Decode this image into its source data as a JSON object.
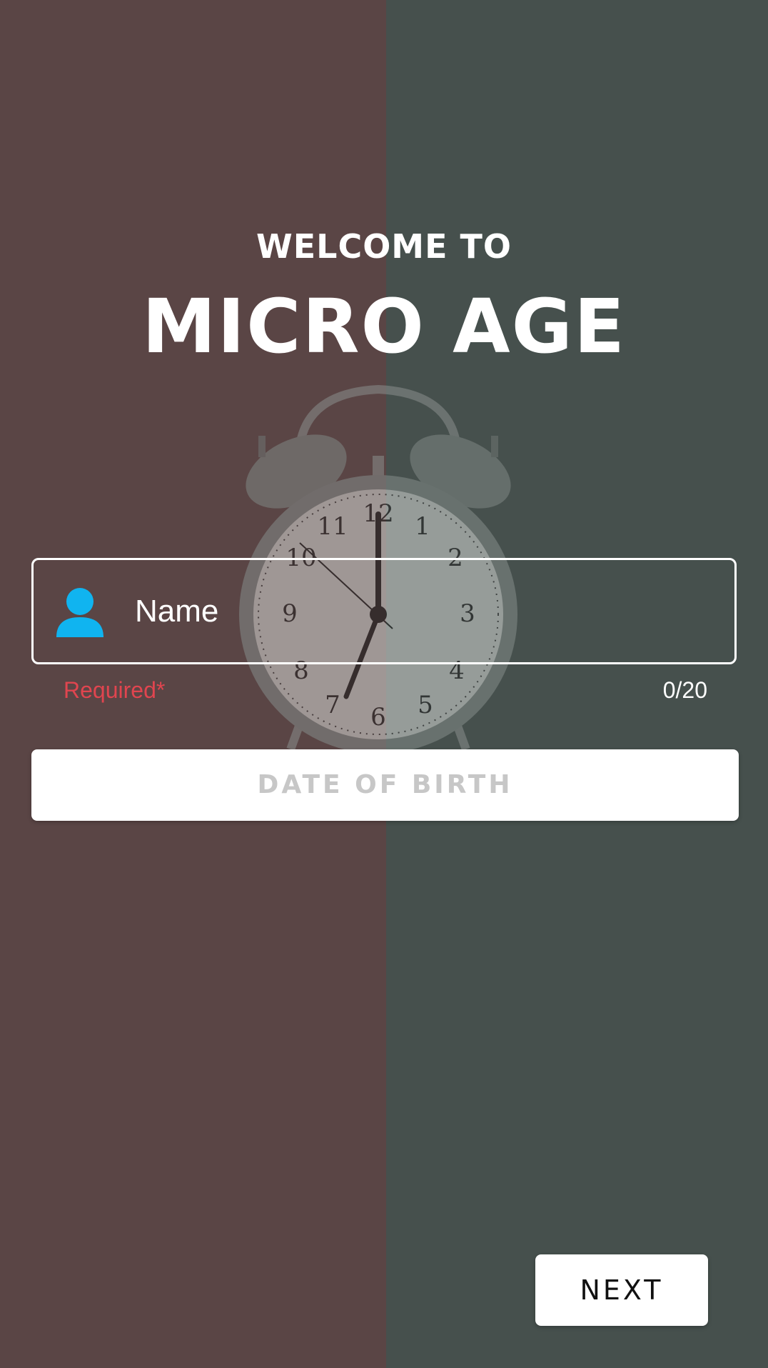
{
  "header": {
    "welcome_text": "WELCOME TO",
    "app_title": "MICRO AGE"
  },
  "form": {
    "name_field": {
      "icon": "person-icon",
      "placeholder": "Name",
      "value": "",
      "helper_text": "Required*",
      "counter": "0/20"
    },
    "dob_button_label": "DATE OF BIRTH",
    "next_button_label": "NEXT"
  },
  "colors": {
    "background_left": "#5a4545",
    "background_right": "#46504d",
    "icon_accent": "#10b4f0",
    "error": "#e0454f"
  }
}
